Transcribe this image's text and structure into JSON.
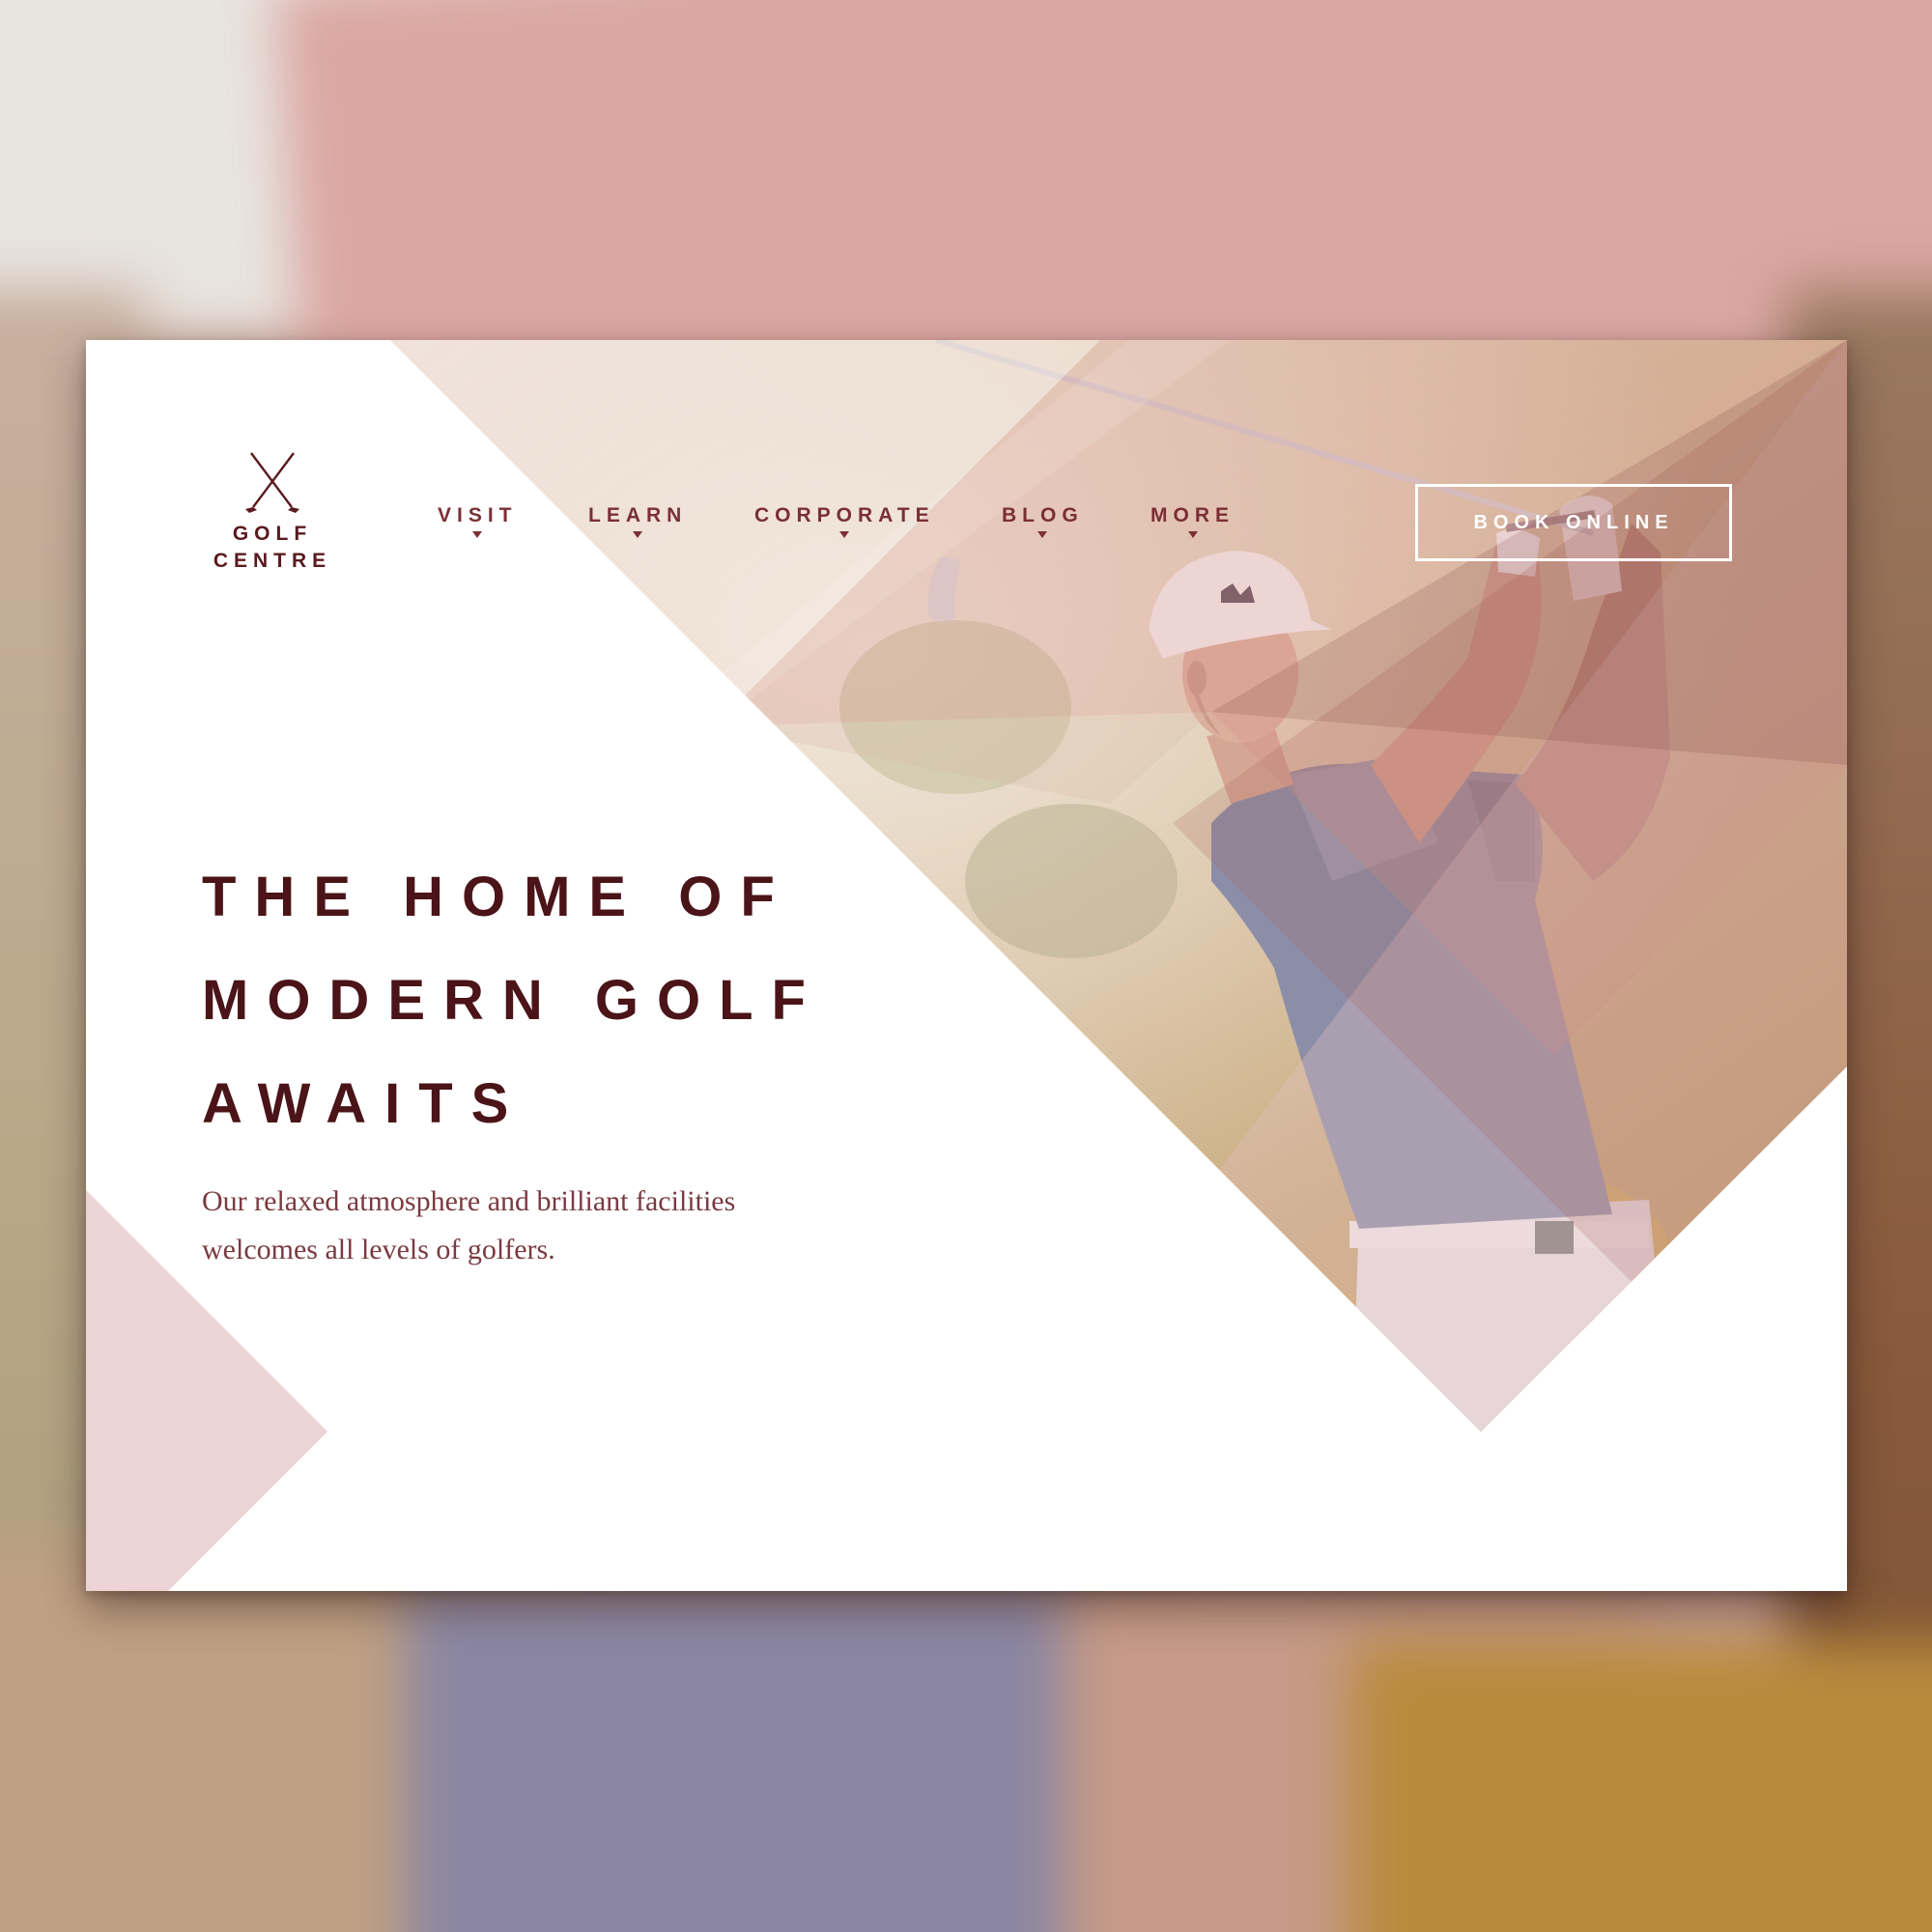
{
  "logo": {
    "icon": "crossed-golf-clubs-icon",
    "line1": "GOLF",
    "line2": "CENTRE"
  },
  "nav": {
    "items": [
      {
        "label": "VISIT",
        "icon": "caret-down-icon"
      },
      {
        "label": "LEARN",
        "icon": "caret-down-icon"
      },
      {
        "label": "CORPORATE",
        "icon": "caret-down-icon"
      },
      {
        "label": "BLOG",
        "icon": "caret-down-icon"
      },
      {
        "label": "MORE",
        "icon": "caret-down-icon"
      }
    ]
  },
  "cta": {
    "label": "BOOK ONLINE"
  },
  "hero": {
    "headline_lines": [
      "THE HOME OF",
      "MODERN GOLF",
      "AWAITS"
    ],
    "subtext_line1": "Our relaxed atmosphere and brilliant facilities",
    "subtext_line2": "welcomes all levels of golfers."
  },
  "colors": {
    "brand_dark": "#4a1418",
    "brand": "#7a2f35",
    "accent_pink": "#e8c4c2",
    "white": "#ffffff"
  }
}
